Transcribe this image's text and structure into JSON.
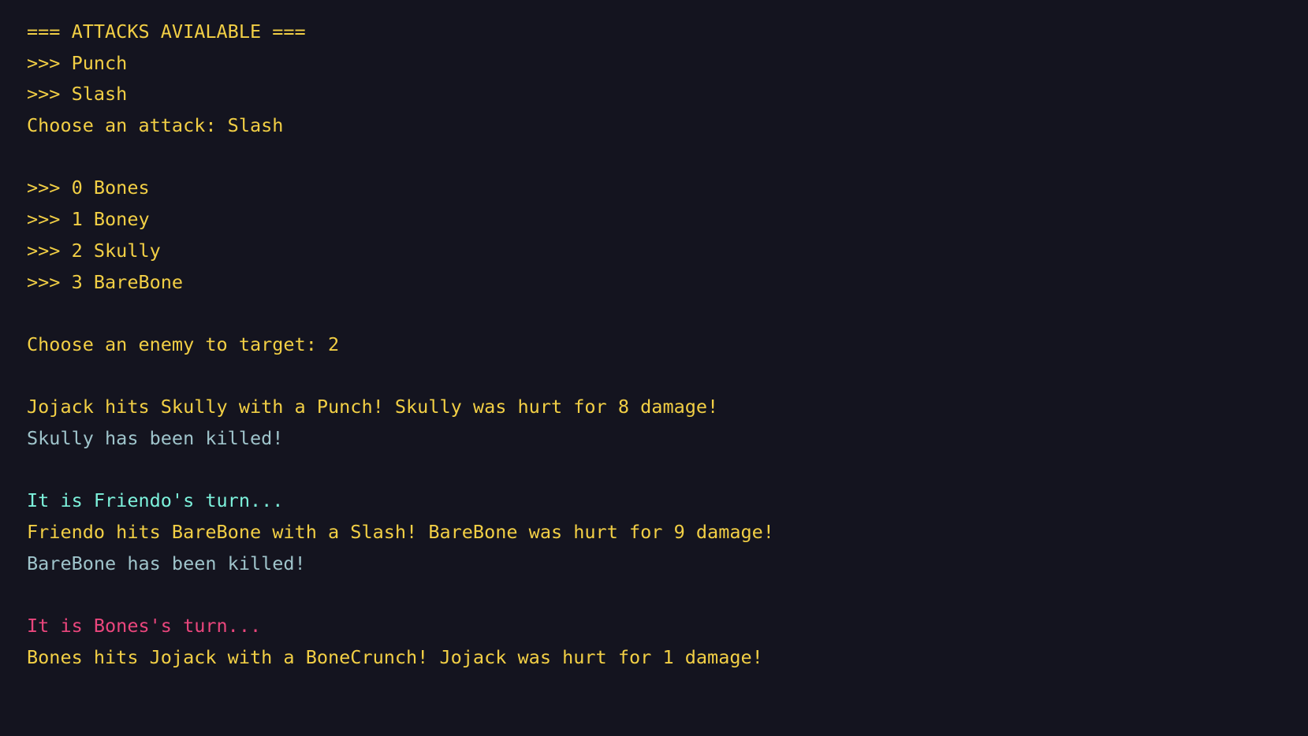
{
  "colors": {
    "background": "#14141f",
    "prompt": "#f2cf45",
    "friendly_turn": "#7df2dc",
    "killed": "#9fc4cb",
    "enemy_turn": "#ea467d"
  },
  "lines": [
    {
      "text": "=== ATTACKS AVIALABLE ===",
      "style": "yellow"
    },
    {
      "text": ">>> Punch",
      "style": "yellow"
    },
    {
      "text": ">>> Slash",
      "style": "yellow"
    },
    {
      "text": "Choose an attack: Slash",
      "style": "yellow"
    },
    {
      "text": "",
      "style": "yellow"
    },
    {
      "text": ">>> 0 Bones",
      "style": "yellow"
    },
    {
      "text": ">>> 1 Boney",
      "style": "yellow"
    },
    {
      "text": ">>> 2 Skully",
      "style": "yellow"
    },
    {
      "text": ">>> 3 BareBone",
      "style": "yellow"
    },
    {
      "text": "",
      "style": "yellow"
    },
    {
      "text": "Choose an enemy to target: 2",
      "style": "yellow"
    },
    {
      "text": "",
      "style": "yellow"
    },
    {
      "text": "Jojack hits Skully with a Punch! Skully was hurt for 8 damage!",
      "style": "yellow"
    },
    {
      "text": "Skully has been killed!",
      "style": "muted"
    },
    {
      "text": "",
      "style": "yellow"
    },
    {
      "text": "It is Friendo's turn...",
      "style": "cyan"
    },
    {
      "text": "Friendo hits BareBone with a Slash! BareBone was hurt for 9 damage!",
      "style": "yellow"
    },
    {
      "text": "BareBone has been killed!",
      "style": "muted"
    },
    {
      "text": "",
      "style": "yellow"
    },
    {
      "text": "It is Bones's turn...",
      "style": "pink"
    },
    {
      "text": "Bones hits Jojack with a BoneCrunch! Jojack was hurt for 1 damage!",
      "style": "yellow"
    }
  ]
}
